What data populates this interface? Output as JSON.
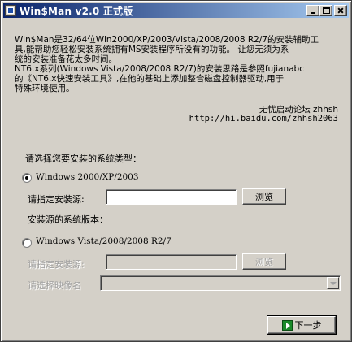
{
  "window": {
    "title": "Win$Man v2.0 正式版",
    "buttons": {
      "minimize": "minimize",
      "maximize": "maximize",
      "close": "close"
    }
  },
  "description": {
    "lines": [
      "Win$Man是32/64位Win2000/XP/2003/Vista/2008/2008 R2/7的安装辅助工",
      "具,能帮助您轻松安装系统拥有MS安装程序所没有的功能。 让您无须为系",
      "统的安装准备花太多时间。",
      "NT6.x系列(Windows Vista/2008/2008 R2/7)的安装思路是参照fujianabc",
      "的《NT6.x快速安装工具》,在他的基础上添加整合磁盘控制器驱动,用于",
      "特殊环境使用。"
    ],
    "credit": "无忧启动论坛 zhhsh",
    "url": "http://hi.baidu.com/zhhsh2063"
  },
  "form": {
    "prompt": "请选择您要安装的系统类型：",
    "option1": {
      "label": "Windows 2000/XP/2003",
      "selected": true,
      "source_label": "请指定安装源:",
      "source_value": "",
      "browse_label": "浏览",
      "version_label": "安装源的系统版本："
    },
    "option2": {
      "label": "Windows Vista/2008/2008 R2/7",
      "selected": false,
      "source_label": "请指定安装源:",
      "source_value": "",
      "browse_label": "浏览",
      "image_label": "请选择映像名",
      "image_value": ""
    },
    "next_label": "下一步"
  },
  "colors": {
    "titlebar_start": "#0a246a",
    "titlebar_end": "#a6caf0",
    "face": "#d4d0c8",
    "disabled_text": "#a0a0a0"
  }
}
